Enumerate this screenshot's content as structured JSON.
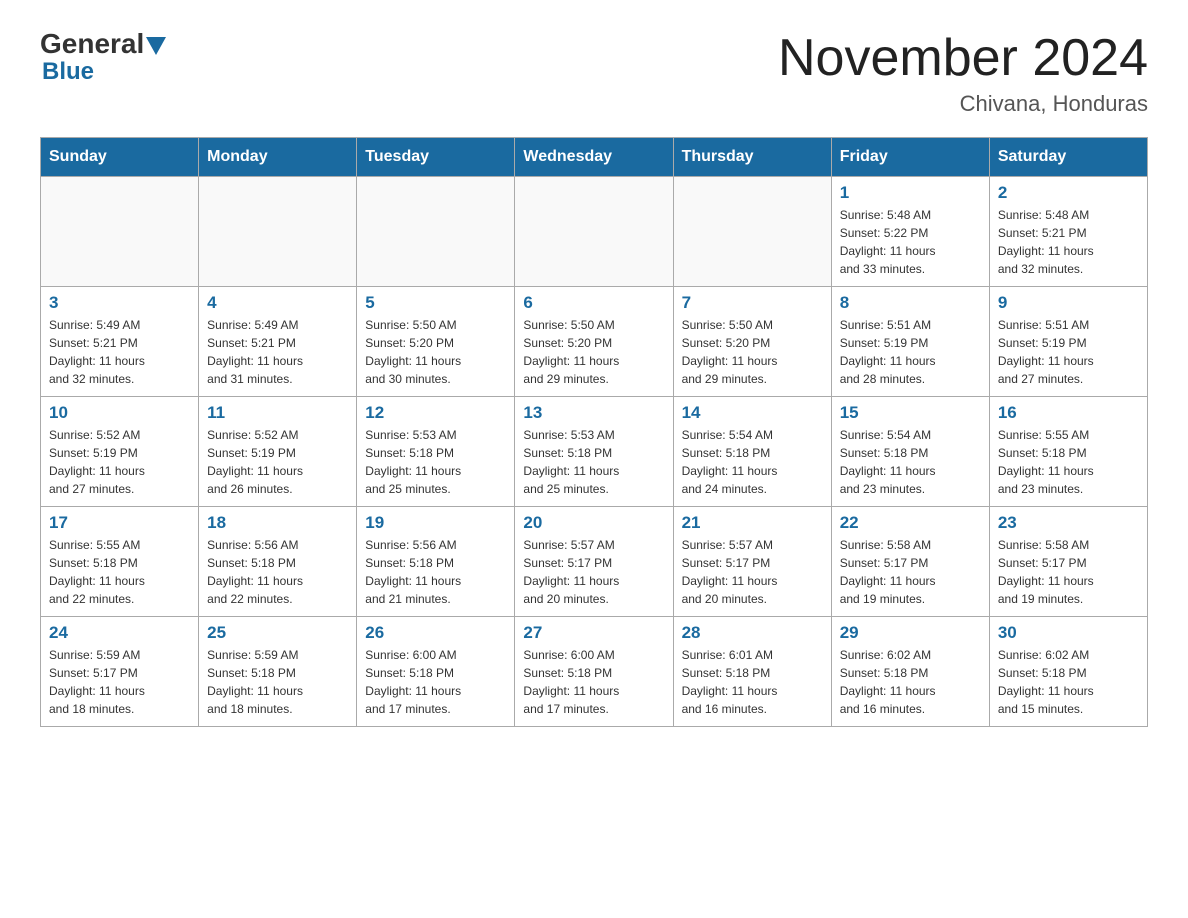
{
  "header": {
    "logo_general": "General",
    "logo_blue": "Blue",
    "month_title": "November 2024",
    "location": "Chivana, Honduras"
  },
  "weekdays": [
    "Sunday",
    "Monday",
    "Tuesday",
    "Wednesday",
    "Thursday",
    "Friday",
    "Saturday"
  ],
  "weeks": [
    [
      {
        "day": "",
        "info": ""
      },
      {
        "day": "",
        "info": ""
      },
      {
        "day": "",
        "info": ""
      },
      {
        "day": "",
        "info": ""
      },
      {
        "day": "",
        "info": ""
      },
      {
        "day": "1",
        "info": "Sunrise: 5:48 AM\nSunset: 5:22 PM\nDaylight: 11 hours\nand 33 minutes."
      },
      {
        "day": "2",
        "info": "Sunrise: 5:48 AM\nSunset: 5:21 PM\nDaylight: 11 hours\nand 32 minutes."
      }
    ],
    [
      {
        "day": "3",
        "info": "Sunrise: 5:49 AM\nSunset: 5:21 PM\nDaylight: 11 hours\nand 32 minutes."
      },
      {
        "day": "4",
        "info": "Sunrise: 5:49 AM\nSunset: 5:21 PM\nDaylight: 11 hours\nand 31 minutes."
      },
      {
        "day": "5",
        "info": "Sunrise: 5:50 AM\nSunset: 5:20 PM\nDaylight: 11 hours\nand 30 minutes."
      },
      {
        "day": "6",
        "info": "Sunrise: 5:50 AM\nSunset: 5:20 PM\nDaylight: 11 hours\nand 29 minutes."
      },
      {
        "day": "7",
        "info": "Sunrise: 5:50 AM\nSunset: 5:20 PM\nDaylight: 11 hours\nand 29 minutes."
      },
      {
        "day": "8",
        "info": "Sunrise: 5:51 AM\nSunset: 5:19 PM\nDaylight: 11 hours\nand 28 minutes."
      },
      {
        "day": "9",
        "info": "Sunrise: 5:51 AM\nSunset: 5:19 PM\nDaylight: 11 hours\nand 27 minutes."
      }
    ],
    [
      {
        "day": "10",
        "info": "Sunrise: 5:52 AM\nSunset: 5:19 PM\nDaylight: 11 hours\nand 27 minutes."
      },
      {
        "day": "11",
        "info": "Sunrise: 5:52 AM\nSunset: 5:19 PM\nDaylight: 11 hours\nand 26 minutes."
      },
      {
        "day": "12",
        "info": "Sunrise: 5:53 AM\nSunset: 5:18 PM\nDaylight: 11 hours\nand 25 minutes."
      },
      {
        "day": "13",
        "info": "Sunrise: 5:53 AM\nSunset: 5:18 PM\nDaylight: 11 hours\nand 25 minutes."
      },
      {
        "day": "14",
        "info": "Sunrise: 5:54 AM\nSunset: 5:18 PM\nDaylight: 11 hours\nand 24 minutes."
      },
      {
        "day": "15",
        "info": "Sunrise: 5:54 AM\nSunset: 5:18 PM\nDaylight: 11 hours\nand 23 minutes."
      },
      {
        "day": "16",
        "info": "Sunrise: 5:55 AM\nSunset: 5:18 PM\nDaylight: 11 hours\nand 23 minutes."
      }
    ],
    [
      {
        "day": "17",
        "info": "Sunrise: 5:55 AM\nSunset: 5:18 PM\nDaylight: 11 hours\nand 22 minutes."
      },
      {
        "day": "18",
        "info": "Sunrise: 5:56 AM\nSunset: 5:18 PM\nDaylight: 11 hours\nand 22 minutes."
      },
      {
        "day": "19",
        "info": "Sunrise: 5:56 AM\nSunset: 5:18 PM\nDaylight: 11 hours\nand 21 minutes."
      },
      {
        "day": "20",
        "info": "Sunrise: 5:57 AM\nSunset: 5:17 PM\nDaylight: 11 hours\nand 20 minutes."
      },
      {
        "day": "21",
        "info": "Sunrise: 5:57 AM\nSunset: 5:17 PM\nDaylight: 11 hours\nand 20 minutes."
      },
      {
        "day": "22",
        "info": "Sunrise: 5:58 AM\nSunset: 5:17 PM\nDaylight: 11 hours\nand 19 minutes."
      },
      {
        "day": "23",
        "info": "Sunrise: 5:58 AM\nSunset: 5:17 PM\nDaylight: 11 hours\nand 19 minutes."
      }
    ],
    [
      {
        "day": "24",
        "info": "Sunrise: 5:59 AM\nSunset: 5:17 PM\nDaylight: 11 hours\nand 18 minutes."
      },
      {
        "day": "25",
        "info": "Sunrise: 5:59 AM\nSunset: 5:18 PM\nDaylight: 11 hours\nand 18 minutes."
      },
      {
        "day": "26",
        "info": "Sunrise: 6:00 AM\nSunset: 5:18 PM\nDaylight: 11 hours\nand 17 minutes."
      },
      {
        "day": "27",
        "info": "Sunrise: 6:00 AM\nSunset: 5:18 PM\nDaylight: 11 hours\nand 17 minutes."
      },
      {
        "day": "28",
        "info": "Sunrise: 6:01 AM\nSunset: 5:18 PM\nDaylight: 11 hours\nand 16 minutes."
      },
      {
        "day": "29",
        "info": "Sunrise: 6:02 AM\nSunset: 5:18 PM\nDaylight: 11 hours\nand 16 minutes."
      },
      {
        "day": "30",
        "info": "Sunrise: 6:02 AM\nSunset: 5:18 PM\nDaylight: 11 hours\nand 15 minutes."
      }
    ]
  ]
}
